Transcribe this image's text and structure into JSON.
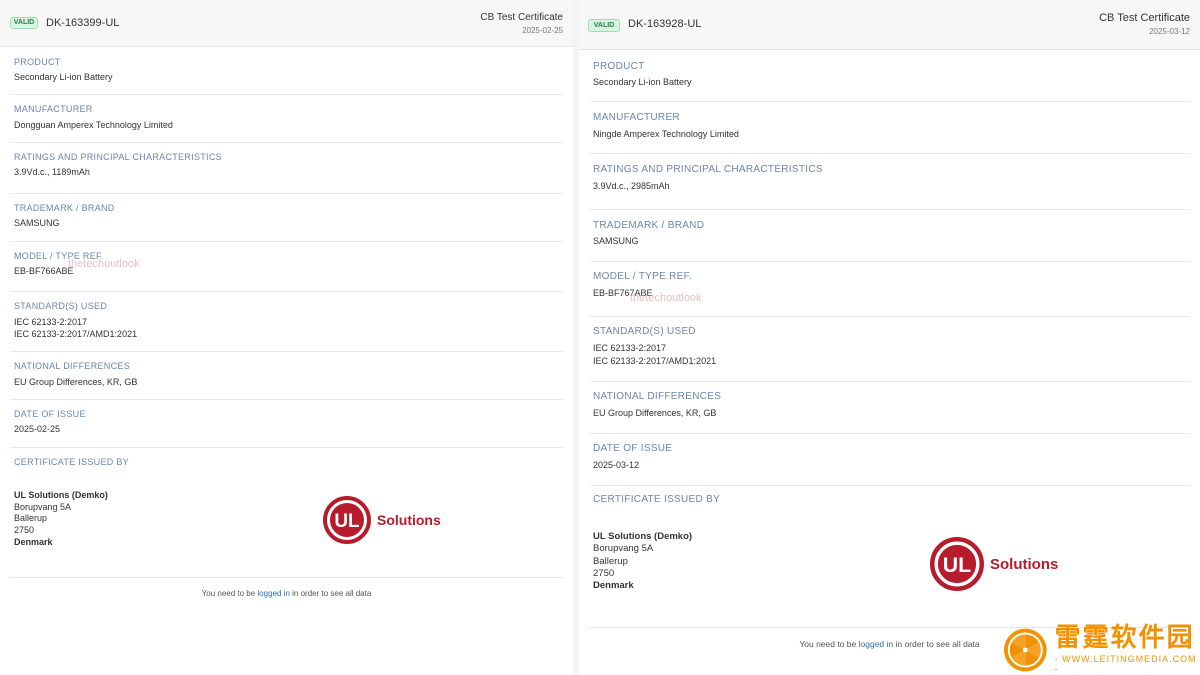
{
  "left": {
    "badge": "VALID",
    "id": "DK-163399-UL",
    "type": "CB Test Certificate",
    "date": "2025-02-25",
    "fields": [
      {
        "label": "PRODUCT",
        "lines": [
          "Secondary Li-ion Battery"
        ]
      },
      {
        "label": "MANUFACTURER",
        "lines": [
          "Dongguan Amperex Technology Limited"
        ]
      },
      {
        "label": "RATINGS AND PRINCIPAL CHARACTERISTICS",
        "lines": [
          "3.9Vd.c., 1189mAh"
        ]
      },
      {
        "label": "TRADEMARK / BRAND",
        "lines": [
          "SAMSUNG"
        ]
      },
      {
        "label": "MODEL / TYPE REF.",
        "lines": [
          "EB-BF766ABE"
        ]
      },
      {
        "label": "STANDARD(S) USED",
        "lines": [
          "IEC 62133-2:2017",
          "IEC 62133-2:2017/AMD1:2021"
        ]
      },
      {
        "label": "NATIONAL DIFFERENCES",
        "lines": [
          "EU Group Differences,  KR,  GB"
        ]
      },
      {
        "label": "DATE OF ISSUE",
        "lines": [
          "2025-02-25"
        ]
      },
      {
        "label": "CERTIFICATE ISSUED BY",
        "lines": []
      }
    ],
    "issuer": {
      "name": "UL Solutions (Demko)",
      "street": "Borupvang 5A",
      "city": "Ballerup",
      "zip": "2750",
      "country": "Denmark"
    },
    "login": {
      "prefix": "You need to be ",
      "link": "logged in",
      "suffix": " in order to see all data"
    }
  },
  "right": {
    "badge": "VALID",
    "id": "DK-163928-UL",
    "type": "CB Test Certificate",
    "date": "2025-03-12",
    "fields": [
      {
        "label": "PRODUCT",
        "lines": [
          "Secondary Li-ion Battery"
        ]
      },
      {
        "label": "MANUFACTURER",
        "lines": [
          "Ningde Amperex Technology Limited"
        ]
      },
      {
        "label": "RATINGS AND PRINCIPAL CHARACTERISTICS",
        "lines": [
          "3.9Vd.c., 2985mAh"
        ]
      },
      {
        "label": "TRADEMARK / BRAND",
        "lines": [
          "SAMSUNG"
        ]
      },
      {
        "label": "MODEL / TYPE REF.",
        "lines": [
          "EB-BF767ABE"
        ]
      },
      {
        "label": "STANDARD(S) USED",
        "lines": [
          "IEC 62133-2:2017",
          "IEC 62133-2:2017/AMD1:2021"
        ]
      },
      {
        "label": "NATIONAL DIFFERENCES",
        "lines": [
          "EU Group Differences,  KR,  GB"
        ]
      },
      {
        "label": "DATE OF ISSUE",
        "lines": [
          "2025-03-12"
        ]
      },
      {
        "label": "CERTIFICATE ISSUED BY",
        "lines": []
      }
    ],
    "issuer": {
      "name": "UL Solutions (Demko)",
      "street": "Borupvang 5A",
      "city": "Ballerup",
      "zip": "2750",
      "country": "Denmark"
    },
    "login": {
      "prefix": "You need to be ",
      "link": "logged in",
      "suffix": " in order to see all data"
    }
  },
  "ul_logo": {
    "mark": "UL",
    "word": "Solutions"
  },
  "watermark": "thetechoutlook",
  "corner": {
    "cn": "雷霆软件园",
    "url": "- WWW.LEITINGMEDIA.COM -"
  },
  "colors": {
    "valid_bg": "#d8f4e3",
    "label": "#6d86a8",
    "ul_red": "#b71c2c",
    "link": "#2d6fb5",
    "brand_orange": "#f39200"
  }
}
